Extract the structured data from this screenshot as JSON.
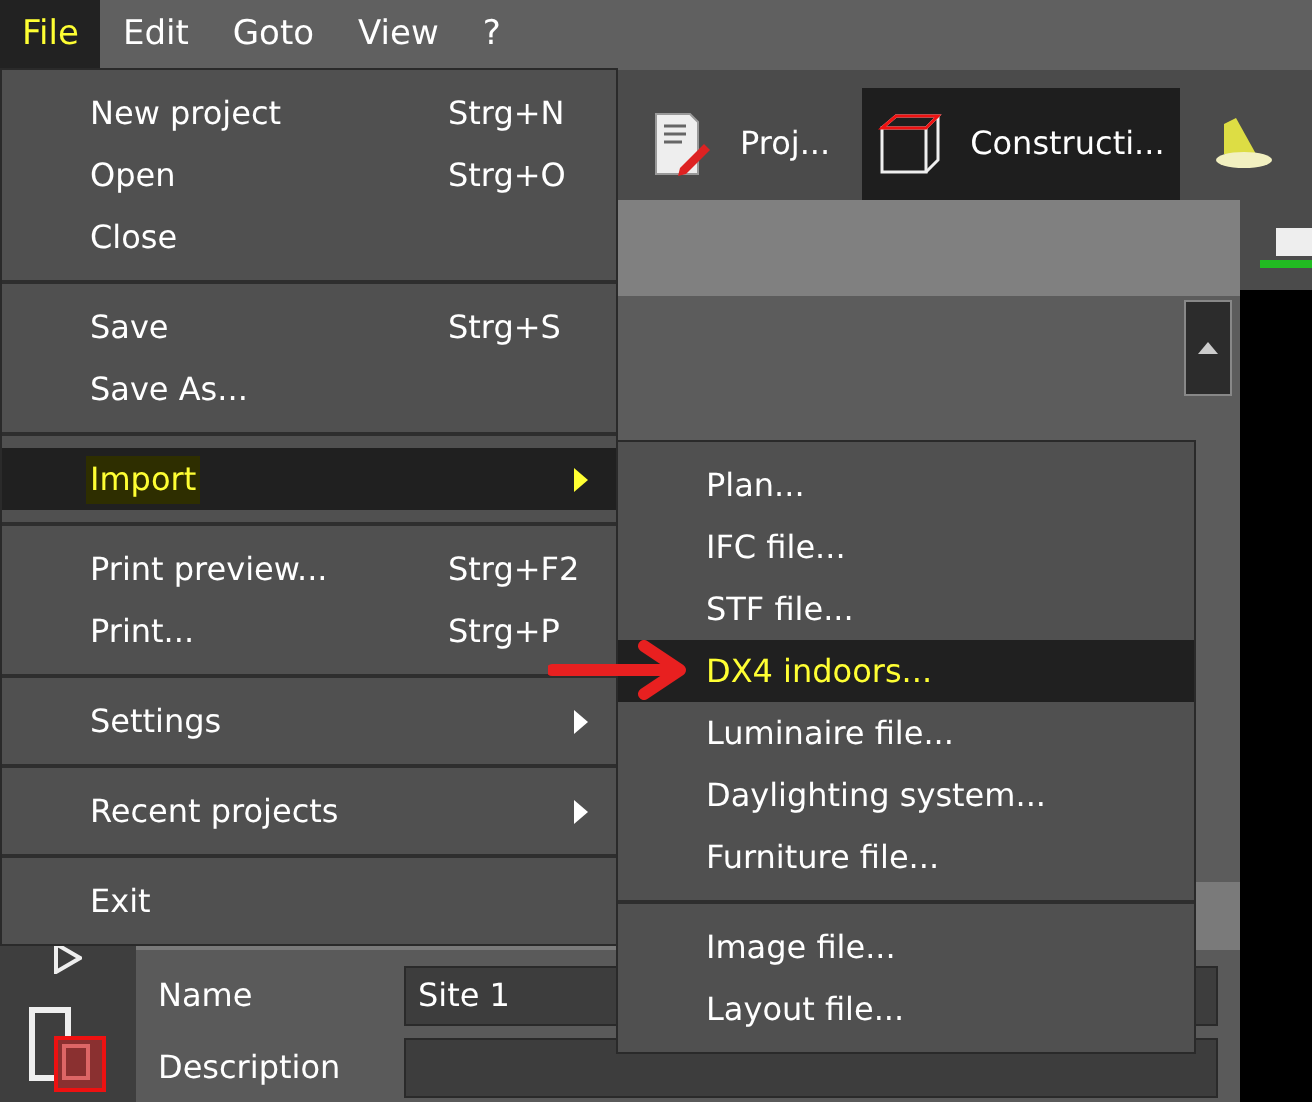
{
  "menubar": [
    {
      "label": "File",
      "selected": true
    },
    {
      "label": "Edit",
      "selected": false
    },
    {
      "label": "Goto",
      "selected": false
    },
    {
      "label": "View",
      "selected": false
    },
    {
      "label": "?",
      "selected": false
    }
  ],
  "tabs": [
    {
      "label": "Proj...",
      "selected": false,
      "kind": "document"
    },
    {
      "label": "Constructi...",
      "selected": true,
      "kind": "cube"
    },
    {
      "kind": "lamp",
      "selected": false
    }
  ],
  "file_menu": [
    [
      {
        "label": "New project",
        "shortcut": "Strg+N",
        "submenu": false,
        "selected": false
      },
      {
        "label": "Open",
        "shortcut": "Strg+O",
        "submenu": false,
        "selected": false
      },
      {
        "label": "Close",
        "submenu": false,
        "selected": false
      }
    ],
    [
      {
        "label": "Save",
        "shortcut": "Strg+S",
        "submenu": false,
        "selected": false
      },
      {
        "label": "Save As...",
        "submenu": false,
        "selected": false
      }
    ],
    [
      {
        "label": "Import",
        "submenu": true,
        "selected": true
      }
    ],
    [
      {
        "label": "Print preview...",
        "shortcut": "Strg+F2",
        "submenu": false,
        "selected": false
      },
      {
        "label": "Print...",
        "shortcut": "Strg+P",
        "submenu": false,
        "selected": false
      }
    ],
    [
      {
        "label": "Settings",
        "submenu": true,
        "selected": false
      }
    ],
    [
      {
        "label": "Recent projects",
        "submenu": true,
        "selected": false
      }
    ],
    [
      {
        "label": "Exit",
        "submenu": false,
        "selected": false
      }
    ]
  ],
  "import_menu": [
    [
      {
        "label": "Plan...",
        "selected": false
      },
      {
        "label": "IFC file...",
        "selected": false
      },
      {
        "label": "STF file...",
        "selected": false
      },
      {
        "label": "DX4 indoors...",
        "selected": true
      },
      {
        "label": "Luminaire file...",
        "selected": false
      },
      {
        "label": "Daylighting system...",
        "selected": false
      },
      {
        "label": "Furniture file...",
        "selected": false
      }
    ],
    [
      {
        "label": "Image file...",
        "selected": false
      },
      {
        "label": "Layout file...",
        "selected": false
      }
    ]
  ],
  "fields": [
    {
      "label": "Name",
      "value": "Site 1"
    },
    {
      "label": "Description"
    }
  ]
}
